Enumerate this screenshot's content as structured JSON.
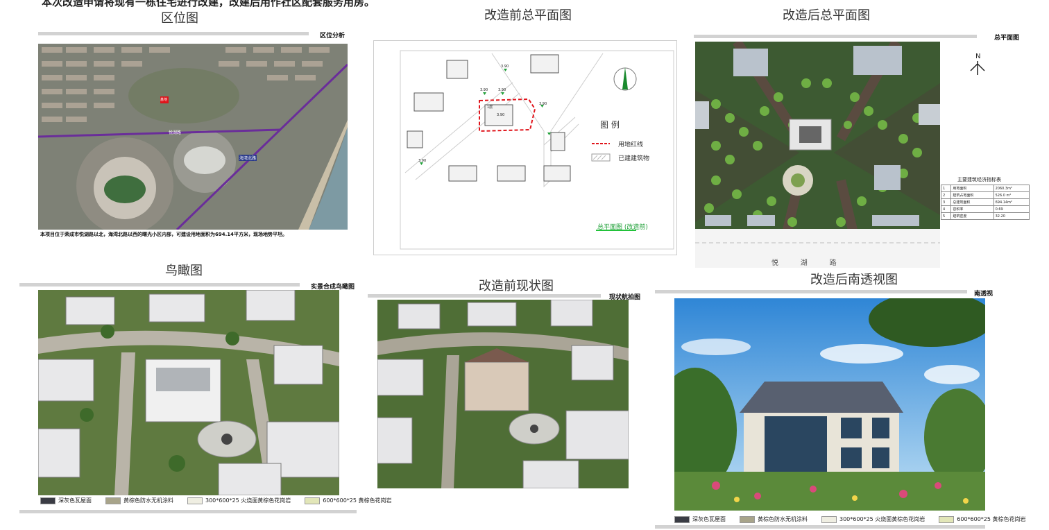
{
  "top_line": "本次改造申请将现有一栋住宅进行改建，改建后用作社区配套服务用房。",
  "sections": {
    "location": {
      "title": "区位图",
      "tag": "区位分析",
      "caption": "本项目位于荣成市悦湖路以北，海湾北路以西的曙光小区内部，可建设用地面积为694.14平方米，现场地势平坦。",
      "road_label_1": "悦湖路",
      "road_label_2": "海湾北路",
      "site_marker": "基地"
    },
    "before_plan": {
      "title": "改造前总平面图",
      "legend_title": "图  例",
      "legend_items": [
        "用地红线",
        "已建建筑物"
      ],
      "plan_label": "总平面图 (改造前)",
      "elevations": [
        "3.90",
        "3.90",
        "3.90",
        "3.90",
        "3.90",
        "3.90"
      ],
      "inner_labels": [
        "1层",
        "3.90"
      ]
    },
    "after_plan": {
      "title": "改造后总平面图",
      "tag": "总平面图",
      "north": "N",
      "road_name": "悦          湖          路",
      "table_title": "主要建筑经济指标表",
      "table_rows": [
        [
          "1",
          "用地面积",
          "2060.3m²"
        ],
        [
          "2",
          "建筑占地面积",
          "526.0 m²"
        ],
        [
          "3",
          "总建筑面积",
          "694.14m²"
        ],
        [
          "4",
          "容积率",
          "0.69"
        ],
        [
          "5",
          "建筑密度",
          "32.20"
        ]
      ]
    },
    "aerial": {
      "title": "鸟瞰图",
      "tag": "实景合成鸟瞰图"
    },
    "current": {
      "title": "改造前现状图",
      "tag": "现状航拍图"
    },
    "perspective": {
      "title": "改造后南透视图",
      "tag": "南透视"
    }
  },
  "materials": [
    {
      "label": "深灰色瓦屋面",
      "color": "#3a3c44"
    },
    {
      "label": "黄棕色防水无机涂料",
      "color": "#a8a48a"
    },
    {
      "label": "300*600*25  火烧面黄棕色花岗岩",
      "color": "#efeee2"
    },
    {
      "label": "600*600*25  黄棕色花岗岩",
      "color": "#e2e6b8"
    }
  ]
}
